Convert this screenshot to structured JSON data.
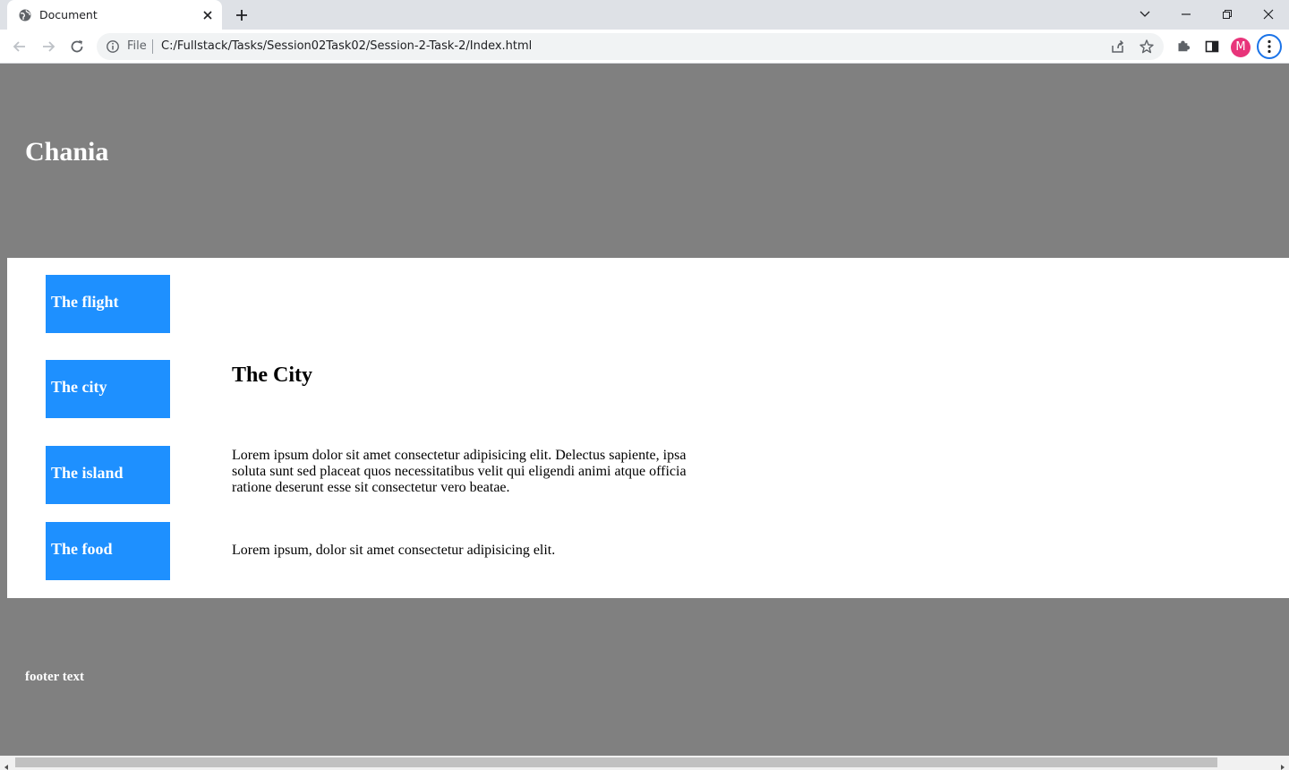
{
  "browser": {
    "tab_title": "Document",
    "scheme_label": "File",
    "url": "C:/Fullstack/Tasks/Session02Task02/Session-2-Task-2/Index.html",
    "profile_initial": "M",
    "profile_color": "#e8347a",
    "icons": [
      "globe-icon",
      "close-icon",
      "plus-icon",
      "chevron-down-icon",
      "minimize-icon",
      "restore-icon",
      "close-window-icon",
      "back-arrow-icon",
      "forward-arrow-icon",
      "reload-icon",
      "info-icon",
      "share-icon",
      "star-icon",
      "puzzle-icon",
      "side-panel-icon",
      "kebab-menu-icon"
    ]
  },
  "page": {
    "header_title": "Chania",
    "nav": [
      {
        "label": "The flight"
      },
      {
        "label": "The city"
      },
      {
        "label": "The island"
      },
      {
        "label": "The food"
      }
    ],
    "article": {
      "title": "The City",
      "paragraph1": "Lorem ipsum dolor sit amet consectetur adipisicing elit. Delectus sapiente, ipsa soluta sunt sed placeat quos necessitatibus velit qui eligendi animi atque officia ratione deserunt esse sit consectetur vero beatae.",
      "paragraph2": "Lorem ipsum, dolor sit amet consectetur adipisicing elit."
    },
    "footer_text": "footer text",
    "colors": {
      "header_bg": "#808080",
      "nav_bg": "#1e90ff",
      "main_bg": "#ffffff",
      "text_light": "#ffffff"
    }
  }
}
